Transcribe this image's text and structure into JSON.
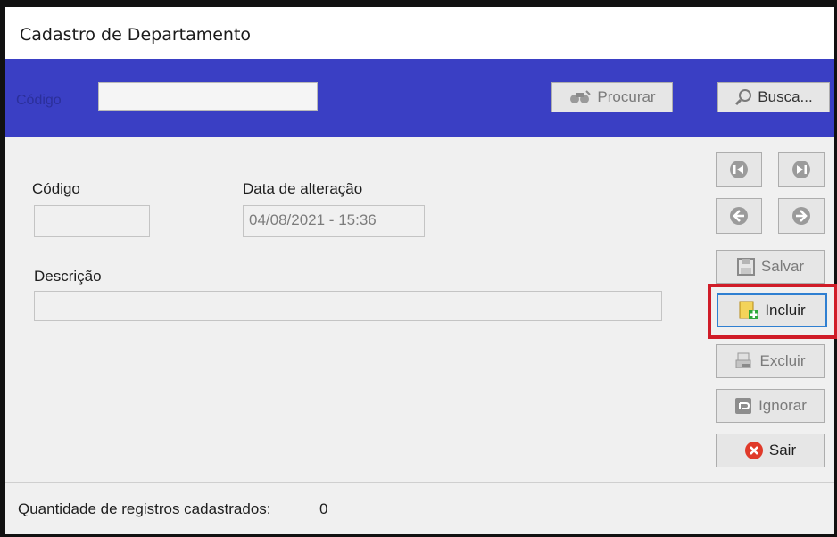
{
  "window": {
    "title": "Cadastro de Departamento"
  },
  "topbar": {
    "code_label": "Código",
    "code_value": "",
    "search_button": "Procurar",
    "find_button": "Busca..."
  },
  "form": {
    "code_label": "Código",
    "code_value": "",
    "date_label": "Data de alteração",
    "date_value": "04/08/2021 - 15:36",
    "description_label": "Descrição",
    "description_value": ""
  },
  "actions": {
    "save": "Salvar",
    "include": "Incluir",
    "delete": "Excluir",
    "ignore": "Ignorar",
    "exit": "Sair"
  },
  "status": {
    "records_label": "Quantidade de registros cadastrados:",
    "records_count": "0"
  },
  "icons": {
    "nav_first": "first-record-icon",
    "nav_last": "last-record-icon",
    "nav_prev": "previous-record-icon",
    "nav_next": "next-record-icon",
    "save": "floppy-disk-icon",
    "include": "add-document-icon",
    "delete": "printer-delete-icon",
    "ignore": "undo-icon",
    "exit": "close-icon",
    "search": "binoculars-icon",
    "find": "magnifier-icon"
  },
  "colors": {
    "topbar_bg": "#3a3fc4",
    "highlight": "#d01c28",
    "include_border": "#2f7fd1"
  }
}
